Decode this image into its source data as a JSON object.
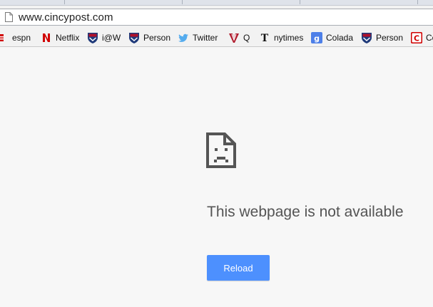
{
  "omnibox": {
    "url": "www.cincypost.com",
    "icon": "page-icon"
  },
  "bookmarks": [
    {
      "label": "espn",
      "icon": "espn-icon",
      "color": "#d00000"
    },
    {
      "label": "Netflix",
      "icon": "netflix-icon",
      "color": "#d00000"
    },
    {
      "label": "i@W",
      "icon": "penn-shield-icon",
      "color": "#1f3a7a"
    },
    {
      "label": "Person",
      "icon": "penn-shield-icon",
      "color": "#1f3a7a"
    },
    {
      "label": "Twitter",
      "icon": "twitter-bird-icon",
      "color": "#55acee"
    },
    {
      "label": "Q",
      "icon": "quinnipiac-q-icon",
      "color": "#b01c2e"
    },
    {
      "label": "nytimes",
      "icon": "nytimes-t-icon",
      "color": "#111111"
    },
    {
      "label": "Colada",
      "icon": "google-g-icon",
      "color": "#4d7fe8"
    },
    {
      "label": "Person",
      "icon": "penn-shield-icon",
      "color": "#1f3a7a"
    },
    {
      "label": "Co",
      "icon": "c-logo-icon",
      "color": "#d00000"
    }
  ],
  "error": {
    "icon": "sad-document-icon",
    "title": "This webpage is not available",
    "reload_label": "Reload",
    "button_color": "#4d90fe"
  }
}
